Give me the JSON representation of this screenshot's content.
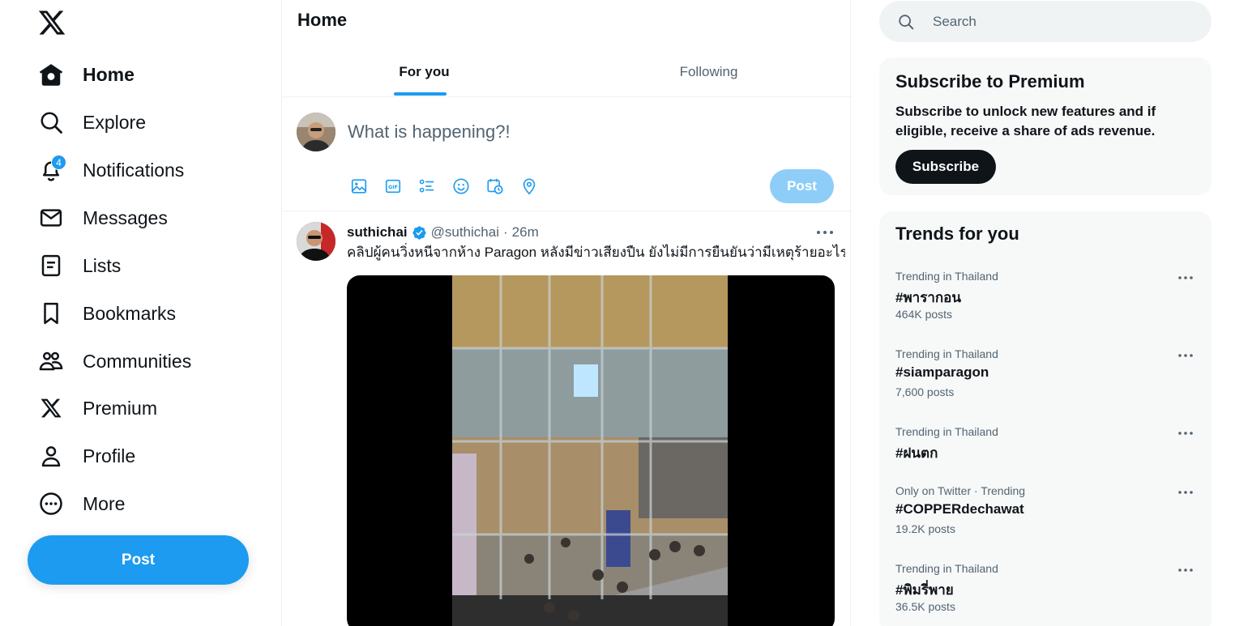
{
  "nav": {
    "logo_icon": "x-logo-icon",
    "items": [
      {
        "label": "Home",
        "icon": "home-icon",
        "active": true
      },
      {
        "label": "Explore",
        "icon": "search-icon"
      },
      {
        "label": "Notifications",
        "icon": "bell-icon",
        "badge": "4"
      },
      {
        "label": "Messages",
        "icon": "envelope-icon"
      },
      {
        "label": "Lists",
        "icon": "list-icon"
      },
      {
        "label": "Bookmarks",
        "icon": "bookmark-icon"
      },
      {
        "label": "Communities",
        "icon": "people-icon"
      },
      {
        "label": "Premium",
        "icon": "x-logo-icon"
      },
      {
        "label": "Profile",
        "icon": "person-icon"
      },
      {
        "label": "More",
        "icon": "more-circle-icon"
      }
    ],
    "post_button": "Post"
  },
  "main": {
    "title": "Home",
    "tabs": [
      {
        "label": "For you",
        "active": true
      },
      {
        "label": "Following",
        "active": false
      }
    ],
    "compose": {
      "placeholder": "What is happening?!",
      "tools": [
        "image-icon",
        "gif-icon",
        "poll-icon",
        "emoji-icon",
        "schedule-icon",
        "location-icon"
      ],
      "post_button": "Post"
    },
    "tweet": {
      "name": "suthichai",
      "verified": true,
      "handle": "@suthichai",
      "separator": "·",
      "time": "26m",
      "text": "คลิปผู้คนวิ่งหนีจากห้าง Paragon หลังมีข่าวเสียงปืน ยังไม่มีการยืนยันว่ามีเหตุร้ายอะไร"
    }
  },
  "right": {
    "search": {
      "placeholder": "Search"
    },
    "premium": {
      "title": "Subscribe to Premium",
      "text": "Subscribe to unlock new features and if eligible, receive a share of ads revenue.",
      "button": "Subscribe"
    },
    "trends": {
      "title": "Trends for you",
      "items": [
        {
          "context": "Trending in Thailand",
          "name": "#พารากอน",
          "count": "464K posts"
        },
        {
          "context": "Trending in Thailand",
          "name": "#siamparagon",
          "count": "7,600 posts"
        },
        {
          "context": "Trending in Thailand",
          "name": "#ฝนตก",
          "count": ""
        },
        {
          "context": "Only on Twitter · Trending",
          "name": "#COPPERdechawat",
          "count": "19.2K posts"
        },
        {
          "context": "Trending in Thailand",
          "name": "#พิมรี่พาย",
          "count": "36.5K posts"
        }
      ]
    }
  },
  "colors": {
    "accent": "#1d9bf0",
    "text": "#0f1419",
    "muted": "#536471",
    "card_bg": "#f7f9f9"
  }
}
